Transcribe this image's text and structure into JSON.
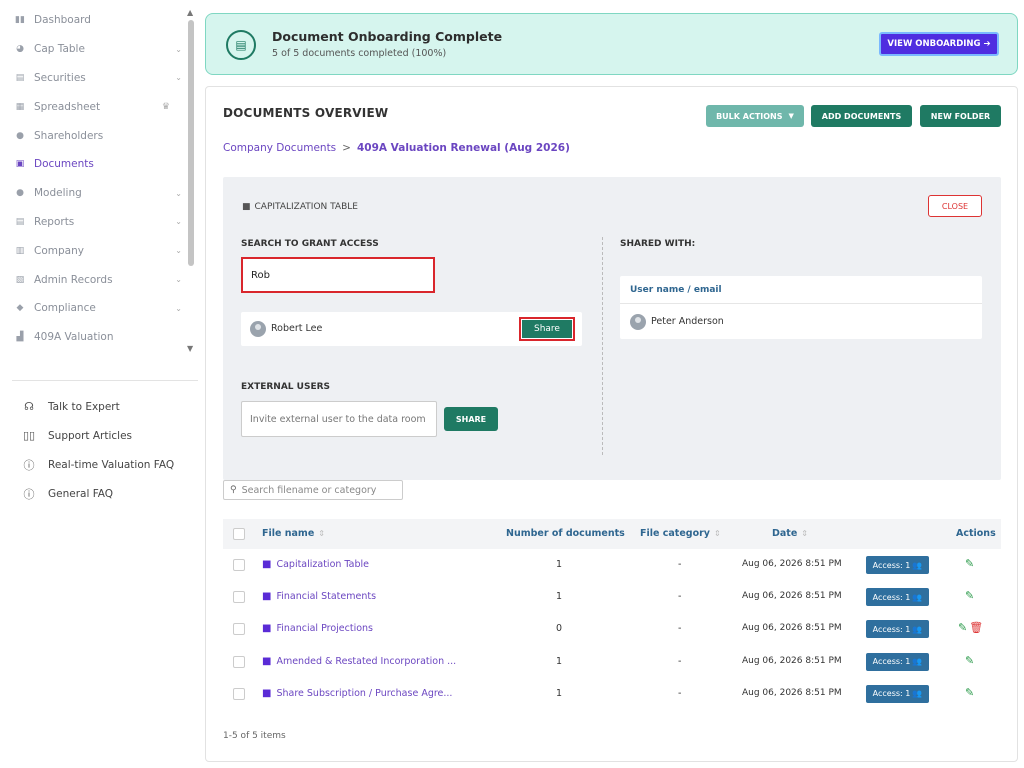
{
  "sidebar": {
    "items": [
      {
        "label": "Dashboard",
        "icon": "dashboard-icon",
        "chevron": false
      },
      {
        "label": "Cap Table",
        "icon": "pie-chart-icon",
        "chevron": true
      },
      {
        "label": "Securities",
        "icon": "clipboard-icon",
        "chevron": true
      },
      {
        "label": "Spreadsheet",
        "icon": "grid-icon",
        "chevron": false,
        "crown": true
      },
      {
        "label": "Shareholders",
        "icon": "user-icon",
        "chevron": false
      },
      {
        "label": "Documents",
        "icon": "folder-icon",
        "chevron": false,
        "active": true
      },
      {
        "label": "Modeling",
        "icon": "bulb-icon",
        "chevron": true
      },
      {
        "label": "Reports",
        "icon": "report-icon",
        "chevron": true
      },
      {
        "label": "Company",
        "icon": "building-icon",
        "chevron": true
      },
      {
        "label": "Admin Records",
        "icon": "records-icon",
        "chevron": true
      },
      {
        "label": "Compliance",
        "icon": "shield-icon",
        "chevron": true
      },
      {
        "label": "409A Valuation",
        "icon": "valuation-icon",
        "chevron": false
      }
    ],
    "help": [
      {
        "label": "Talk to Expert",
        "icon": "headset-icon"
      },
      {
        "label": "Support Articles",
        "icon": "book-icon"
      },
      {
        "label": "Real-time Valuation FAQ",
        "icon": "question-icon"
      },
      {
        "label": "General FAQ",
        "icon": "question-icon"
      }
    ]
  },
  "banner": {
    "title": "Document Onboarding Complete",
    "subtitle": "5 of 5 documents completed (100%)",
    "button": "VIEW ONBOARDING ➔"
  },
  "overview": {
    "title": "DOCUMENTS OVERVIEW",
    "bulk_actions": "BULK ACTIONS",
    "add_documents": "ADD DOCUMENTS",
    "new_folder": "NEW FOLDER",
    "breadcrumb_root": "Company Documents",
    "breadcrumb_sep": ">",
    "breadcrumb_current": "409A Valuation Renewal (Aug 2026)"
  },
  "share_panel": {
    "folder_title": "CAPITALIZATION TABLE",
    "close": "CLOSE",
    "search_label": "SEARCH TO GRANT ACCESS",
    "search_value": "Rob",
    "result_name": "Robert Lee",
    "share_button": "Share",
    "external_label": "EXTERNAL USERS",
    "external_placeholder": "Invite external user to the data room",
    "external_share": "SHARE",
    "shared_with_label": "SHARED WITH:",
    "shared_header": "User name / email",
    "shared_users": [
      "Peter Anderson"
    ]
  },
  "file_search_placeholder": "Search filename or category",
  "table": {
    "headers": {
      "file_name": "File name",
      "num_docs": "Number of documents",
      "category": "File category",
      "date": "Date",
      "actions": "Actions"
    },
    "rows": [
      {
        "name": "Capitalization Table",
        "docs": "1",
        "category": "-",
        "date": "Aug 06, 2026 8:51 PM",
        "access": "Access: 1",
        "deletable": false
      },
      {
        "name": "Financial Statements",
        "docs": "1",
        "category": "-",
        "date": "Aug 06, 2026 8:51 PM",
        "access": "Access: 1",
        "deletable": false
      },
      {
        "name": "Financial Projections",
        "docs": "0",
        "category": "-",
        "date": "Aug 06, 2026 8:51 PM",
        "access": "Access: 1",
        "deletable": true
      },
      {
        "name": "Amended & Restated Incorporation ...",
        "docs": "1",
        "category": "-",
        "date": "Aug 06, 2026 8:51 PM",
        "access": "Access: 1",
        "deletable": false
      },
      {
        "name": "Share Subscription / Purchase Agre...",
        "docs": "1",
        "category": "-",
        "date": "Aug 06, 2026 8:51 PM",
        "access": "Access: 1",
        "deletable": false
      }
    ]
  },
  "pager": "1-5 of 5 items",
  "colors": {
    "accent": "#1f7a63",
    "link": "#6b46c1",
    "highlight": "#d9262c",
    "onboard": "#4f2de0"
  }
}
